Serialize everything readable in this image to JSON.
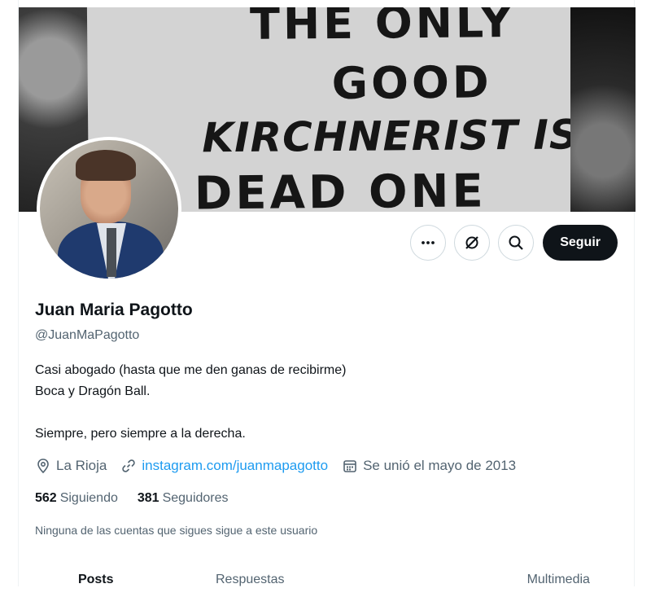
{
  "banner": {
    "sign_lines": [
      "THE ONLY",
      "GOOD",
      "KIRCHNERIST IS A",
      "DEAD ONE"
    ]
  },
  "profile": {
    "name": "Juan Maria Pagotto",
    "handle": "@JuanMaPagotto",
    "bio": [
      "Casi abogado (hasta que me den ganas de recibirme)",
      "Boca y Dragón Ball.",
      "",
      "Siempre, pero siempre a la derecha."
    ],
    "location": "La Rioja",
    "website": "instagram.com/juanmapagotto",
    "joined": "Se unió el mayo de 2013",
    "following_count": "562",
    "following_label": "Siguiendo",
    "followers_count": "381",
    "followers_label": "Seguidores",
    "mutuals_note": "Ninguna de las cuentas que sigues sigue a este usuario"
  },
  "actions": {
    "more_icon": "more-icon",
    "grok_icon": "grok-icon",
    "search_icon": "search-icon",
    "follow_label": "Seguir"
  },
  "tabs": [
    "Posts",
    "Respuestas",
    "",
    "Multimedia"
  ],
  "colors": {
    "accent": "#1d9bf0",
    "text": "#0f1419",
    "muted": "#536471",
    "follow_button": "#0f1419"
  }
}
